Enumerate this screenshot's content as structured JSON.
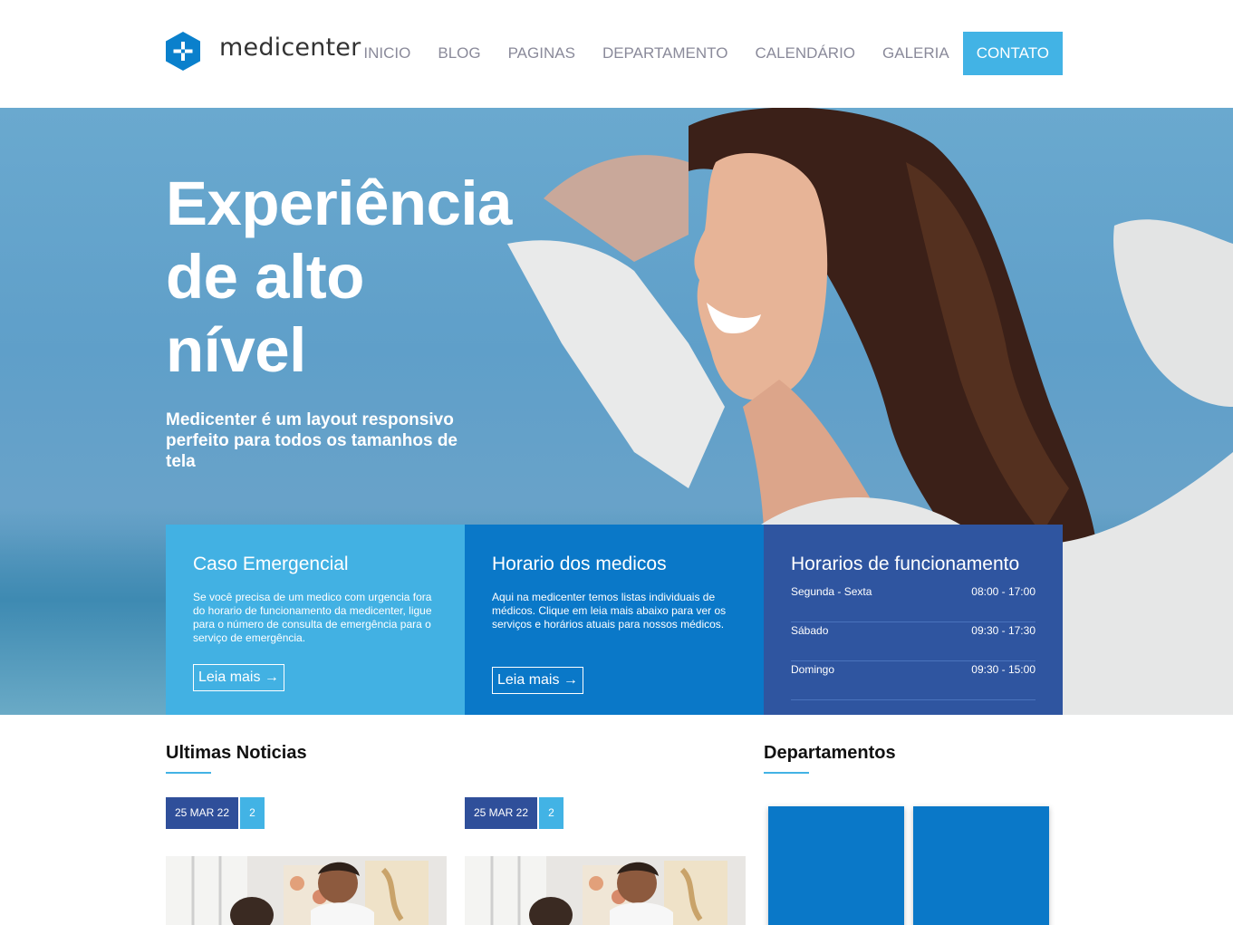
{
  "header": {
    "logo_text": "medicenter",
    "nav": [
      {
        "label": "INICIO",
        "active": false
      },
      {
        "label": "BLOG",
        "active": false
      },
      {
        "label": "PAGINAS",
        "active": false
      },
      {
        "label": "DEPARTAMENTO",
        "active": false
      },
      {
        "label": "CALENDÁRIO",
        "active": false
      },
      {
        "label": "GALERIA",
        "active": false
      },
      {
        "label": "CONTATO",
        "active": true
      }
    ]
  },
  "hero": {
    "title_lines": [
      "Experiência",
      "de alto",
      "nível"
    ],
    "subtitle": "Medicenter é um layout responsivo perfeito para todos os tamanhos de tela"
  },
  "boxes": {
    "emergency": {
      "title": "Caso Emergencial",
      "text": "Se você precisa de um medico com urgencia fora do horario de funcionamento da medicenter, ligue para o número de consulta de emergência para o serviço de emergência.",
      "link": "Leia mais →"
    },
    "doctors": {
      "title": "Horario dos medicos",
      "text": "Aqui na medicenter temos listas individuais de médicos. Clique em leia mais abaixo para ver os serviços e horários atuais para nossos médicos.",
      "link": "Leia mais →"
    },
    "hours": {
      "title": "Horarios de funcionamento",
      "rows": [
        {
          "day": "Segunda - Sexta",
          "time": "08:00 - 17:00"
        },
        {
          "day": "Sábado",
          "time": "09:30 - 17:30"
        },
        {
          "day": "Domingo",
          "time": "09:30 - 15:00"
        }
      ]
    }
  },
  "news": {
    "title": "Ultimas Noticias",
    "posts": [
      {
        "date": "25 MAR 22",
        "comments": "2"
      },
      {
        "date": "25 MAR 22",
        "comments": "2"
      }
    ]
  },
  "departments": {
    "title": "Departamentos"
  },
  "colors": {
    "accent": "#42b3e5",
    "blue_mid": "#0a78c8",
    "blue_dark": "#2f55a0"
  }
}
